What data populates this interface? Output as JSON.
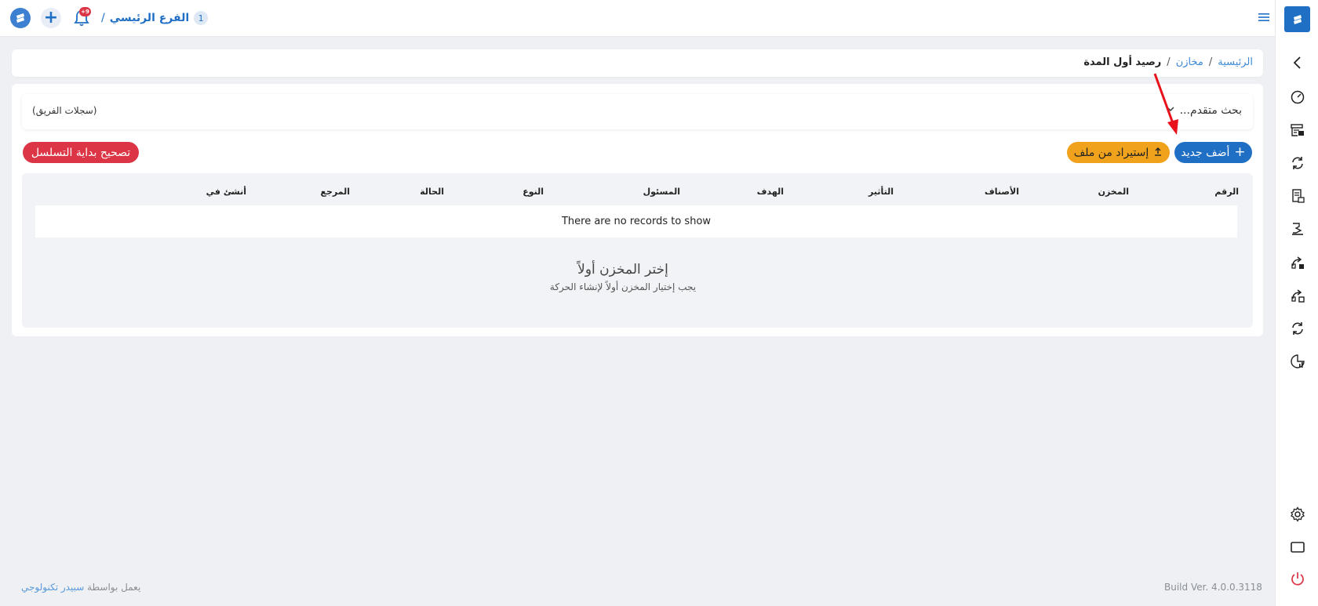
{
  "header": {
    "branch_number": "1",
    "branch_name": "الفرع الرئيسي",
    "branch_separator": "/",
    "notification_count": "+9"
  },
  "breadcrumb": {
    "home": "الرئيسية",
    "stores": "مخازن",
    "current": "رصيد أول المدة",
    "separator": "/"
  },
  "advanced_search": {
    "title": "بحث متقدم...",
    "team_logs": "(سجلات الفريق)"
  },
  "actions": {
    "add_new": "أضف جديد",
    "import_file": "إستيراد من ملف",
    "fix_sequence": "تصحيح بداية التسلسل"
  },
  "table": {
    "columns": [
      "الرقم",
      "المخزن",
      "الأصناف",
      "التأثير",
      "الهدف",
      "المسئول",
      "النوع",
      "الحالة",
      "المرجع",
      "أنشئ في"
    ],
    "empty_message": "There are no records to show"
  },
  "empty_state": {
    "title": "إختر المخزن أولاً",
    "subtitle": "يجب إختيار المخزن أولاً لإنشاء الحركة"
  },
  "footer": {
    "powered_prefix": "يعمل بواسطة",
    "powered_brand": "سبيدر تكنولوجي",
    "build_version": "Build Ver. 4.0.0.3118"
  },
  "colors": {
    "primary": "#1f6fc5",
    "warning": "#f0a21c",
    "danger": "#dc3545",
    "background": "#eef0f4"
  }
}
